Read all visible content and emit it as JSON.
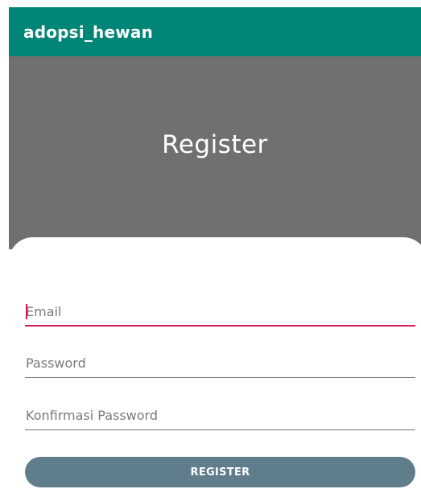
{
  "app_bar": {
    "title": "adopsi_hewan",
    "color": "#008577"
  },
  "hero": {
    "title": "Register",
    "background": "#707070"
  },
  "form": {
    "email": {
      "placeholder": "Email",
      "value": "",
      "focused": true
    },
    "password": {
      "placeholder": "Password",
      "value": ""
    },
    "confirm_password": {
      "placeholder": "Konfirmasi Password",
      "value": ""
    },
    "submit_label": "REGISTER",
    "accent_color": "#d81b60",
    "button_color": "#607d8b"
  }
}
